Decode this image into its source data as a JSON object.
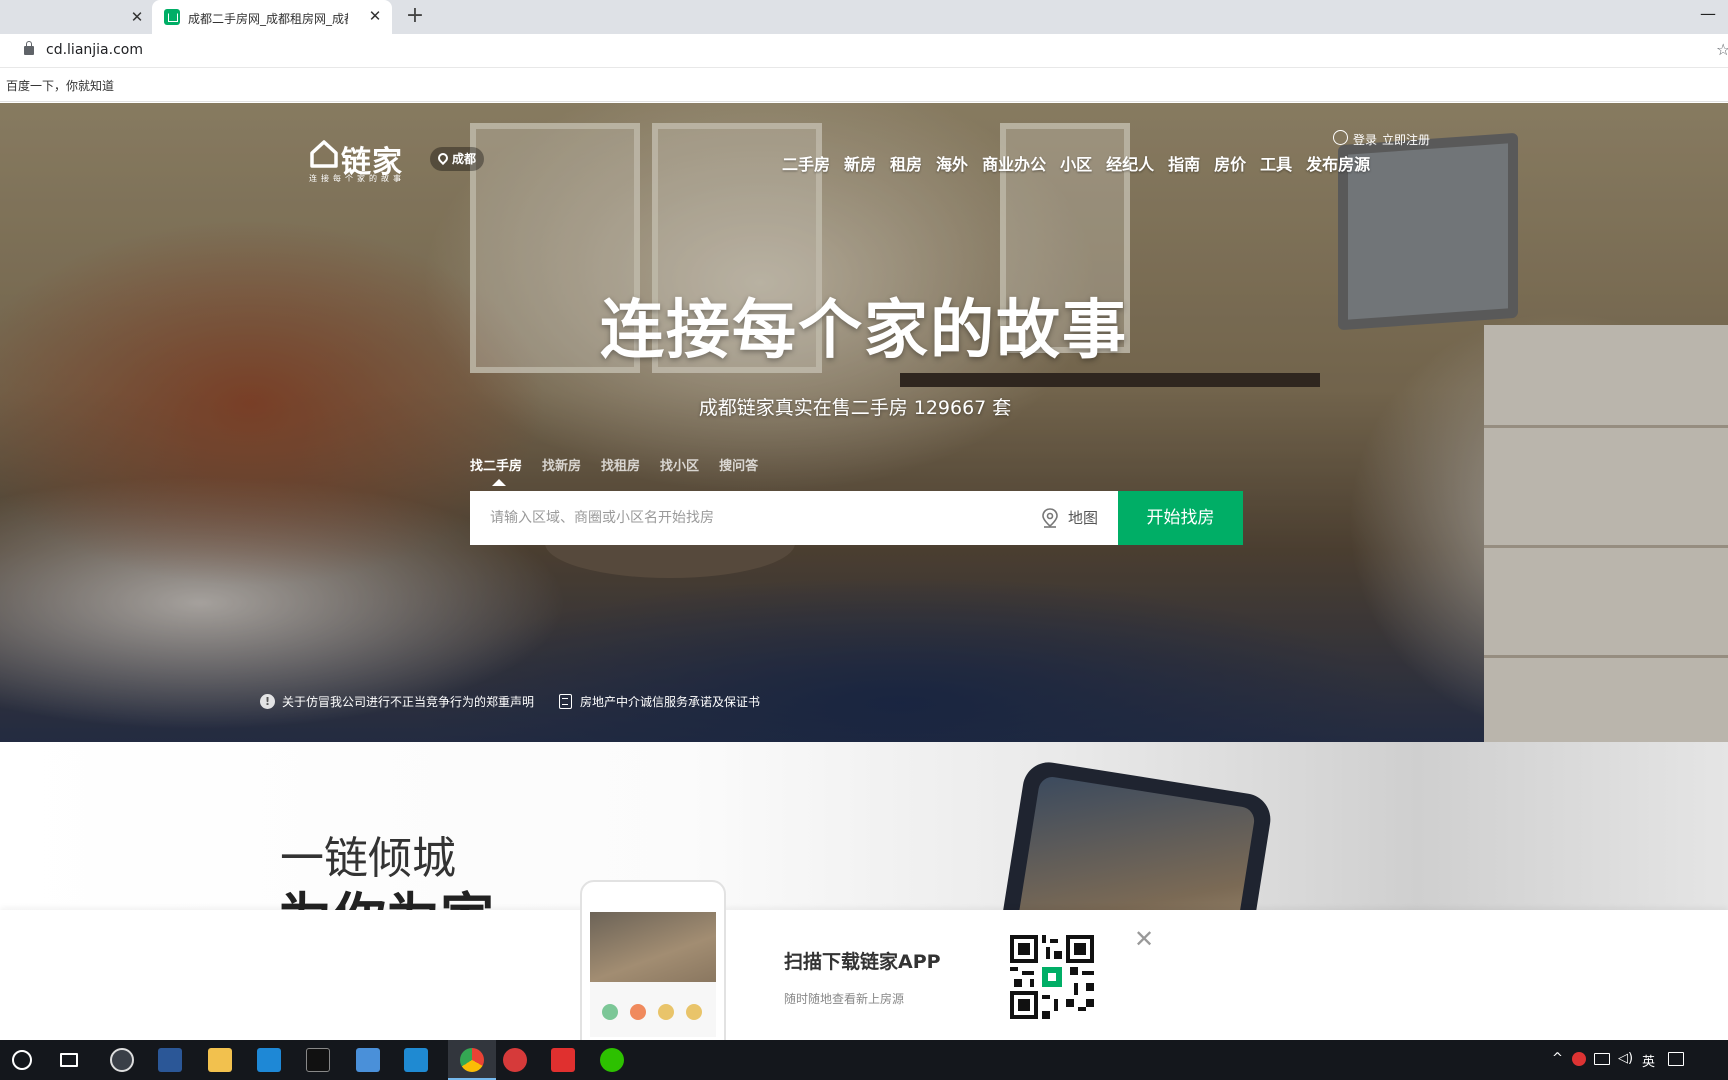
{
  "browser": {
    "tabs": [
      {
        "title": ""
      },
      {
        "title": "成都二手房网_成都租房网_成都"
      }
    ],
    "url": "cd.lianjia.com",
    "bookmark": "百度一下，你就知道"
  },
  "header": {
    "logo_text": "链家",
    "logo_slogan": "连接每个家的故事",
    "city": "成都",
    "login": "登录",
    "register": "立即注册",
    "nav": [
      "二手房",
      "新房",
      "租房",
      "海外",
      "商业办公",
      "小区",
      "经纪人",
      "指南",
      "房价",
      "工具",
      "发布房源"
    ]
  },
  "hero": {
    "title": "连接每个家的故事",
    "subtitle": "成都链家真实在售二手房 129667 套",
    "search_tabs": [
      "找二手房",
      "找新房",
      "找租房",
      "找小区",
      "搜问答"
    ],
    "search_placeholder": "请输入区域、商圈或小区名开始找房",
    "map_label": "地图",
    "search_button": "开始找房",
    "notices": [
      "关于仿冒我公司进行不正当竞争行为的郑重声明",
      "房地产中介诚信服务承诺及保证书"
    ]
  },
  "promo": {
    "line1": "一链倾城",
    "line2": "为你为家"
  },
  "download_banner": {
    "title": "扫描下载链家APP",
    "subtitle": "随时随地查看新上房源"
  },
  "colors": {
    "brand_green": "#00ae66"
  },
  "taskbar": {
    "icons": [
      "cortana-icon",
      "task-view-icon",
      "obs-icon",
      "powershell-icon",
      "file-explorer-icon",
      "mail-icon",
      "terminal-icon",
      "remote-desktop-icon",
      "vscode-icon",
      "chrome-icon",
      "netease-music-icon",
      "wps-icon",
      "wechat-icon"
    ],
    "ime": "英"
  }
}
